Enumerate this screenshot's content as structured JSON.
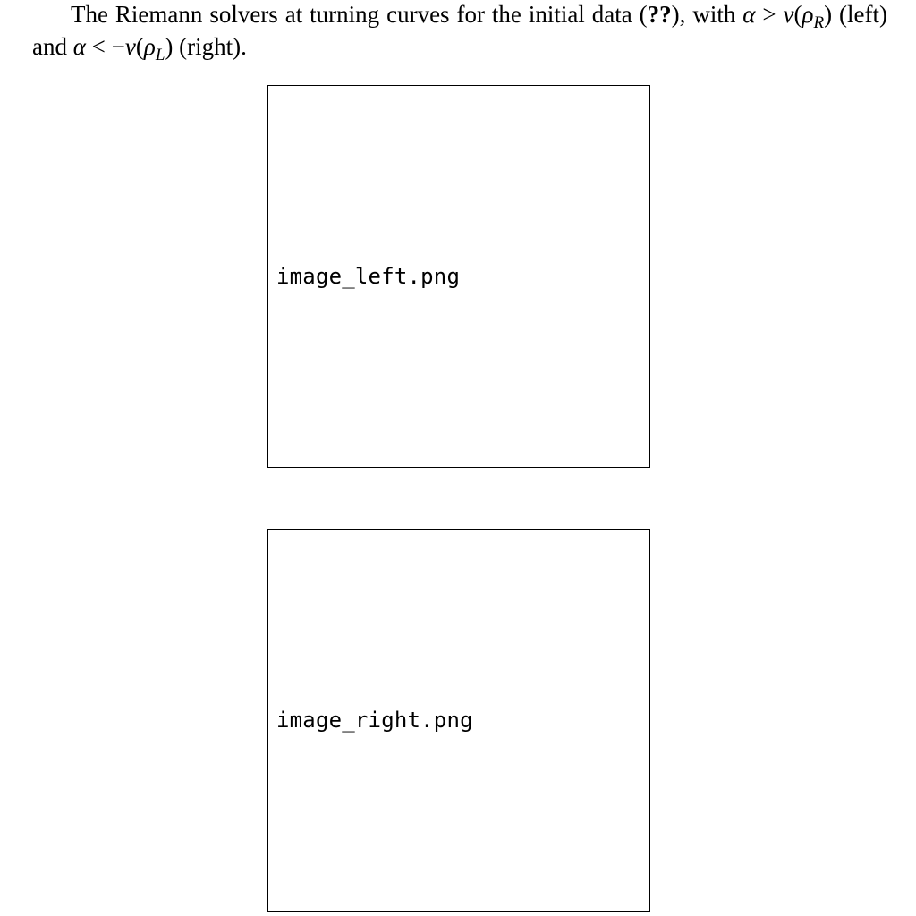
{
  "caption": {
    "text_start": "The Riemann solvers at turning curves for the initial data (",
    "ref": "??",
    "text_with": "), with ",
    "alpha1": "α",
    "gt": " > ",
    "v1": "v",
    "paren_open1": "(",
    "rho1": "ρ",
    "sub1": "R",
    "paren_close1": ")",
    "left_label": " (left) and ",
    "alpha2": "α",
    "lt": " < −",
    "v2": "v",
    "paren_open2": "(",
    "rho2": "ρ",
    "sub2": "L",
    "paren_close2": ")",
    "right_label": " (right)."
  },
  "figures": {
    "left_placeholder": "image_left.png",
    "right_placeholder": "image_right.png"
  }
}
